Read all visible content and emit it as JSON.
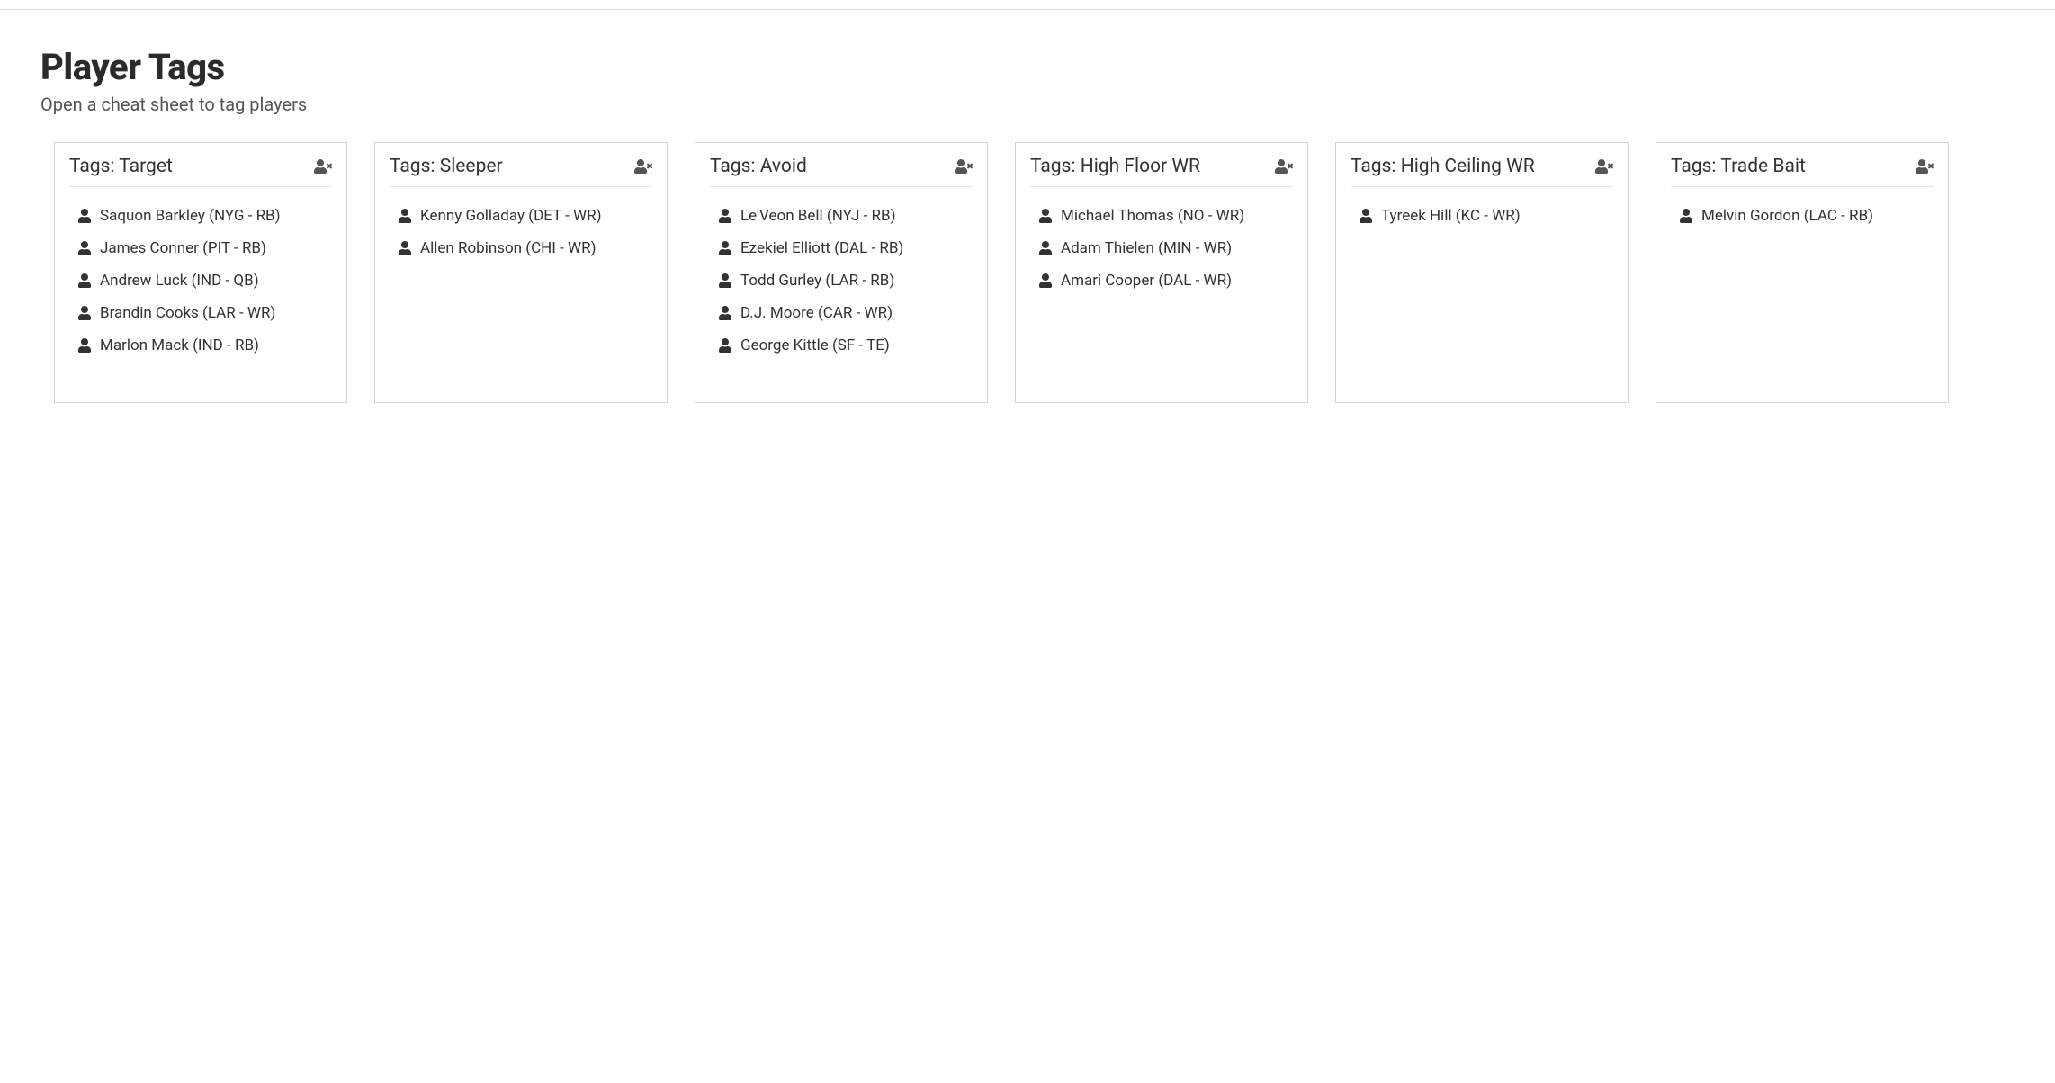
{
  "page": {
    "title": "Player Tags",
    "subtitle": "Open a cheat sheet to tag players"
  },
  "tag_prefix": "Tags: ",
  "cards": [
    {
      "name": "Target",
      "players": [
        "Saquon Barkley (NYG - RB)",
        "James Conner (PIT - RB)",
        "Andrew Luck (IND - QB)",
        "Brandin Cooks (LAR - WR)",
        "Marlon Mack (IND - RB)"
      ]
    },
    {
      "name": "Sleeper",
      "players": [
        "Kenny Golladay (DET - WR)",
        "Allen Robinson (CHI - WR)"
      ]
    },
    {
      "name": "Avoid",
      "players": [
        "Le'Veon Bell (NYJ - RB)",
        "Ezekiel Elliott (DAL - RB)",
        "Todd Gurley (LAR - RB)",
        "D.J. Moore (CAR - WR)",
        "George Kittle (SF - TE)"
      ]
    },
    {
      "name": "High Floor WR",
      "players": [
        "Michael Thomas (NO - WR)",
        "Adam Thielen (MIN - WR)",
        "Amari Cooper (DAL - WR)"
      ]
    },
    {
      "name": "High Ceiling WR",
      "players": [
        "Tyreek Hill (KC - WR)"
      ]
    },
    {
      "name": "Trade Bait",
      "players": [
        "Melvin Gordon (LAC - RB)"
      ]
    }
  ]
}
